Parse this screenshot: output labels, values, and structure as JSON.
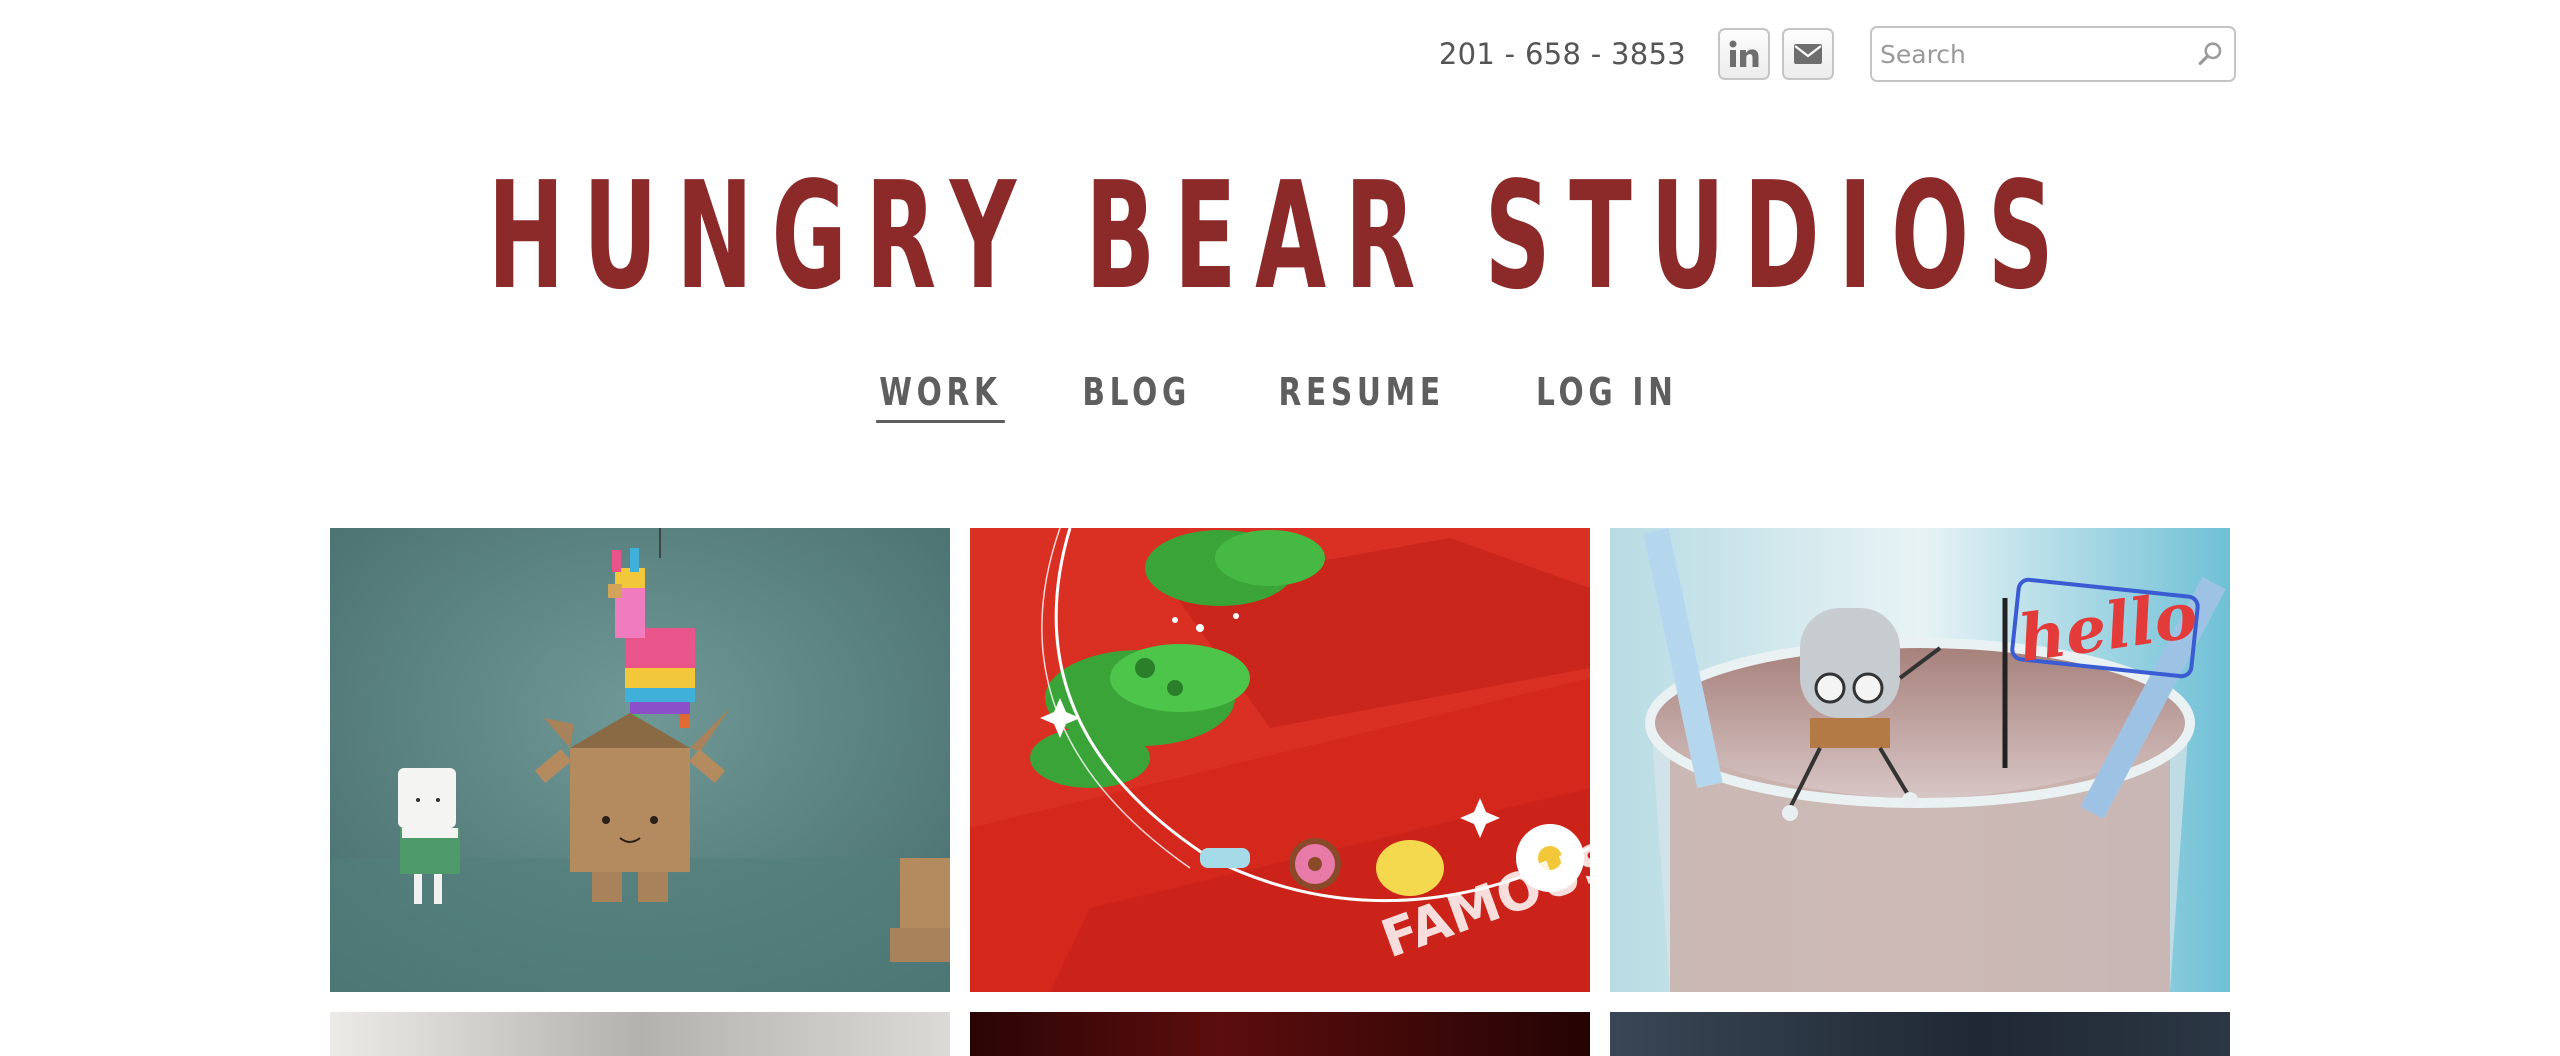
{
  "header": {
    "phone": "201 - 658 - 3853",
    "social": [
      {
        "name": "LinkedIn",
        "icon": "linkedin-icon",
        "glyph": "in"
      },
      {
        "name": "Email",
        "icon": "mail-icon"
      }
    ],
    "search": {
      "placeholder": "Search",
      "value": ""
    }
  },
  "site": {
    "title": "HUNGRY BEAR STUDIOS",
    "title_color": "#8c2a2a"
  },
  "nav": {
    "items": [
      {
        "label": "WORK",
        "active": true
      },
      {
        "label": "BLOG",
        "active": false
      },
      {
        "label": "RESUME",
        "active": false
      },
      {
        "label": "LOG IN",
        "active": false
      }
    ]
  },
  "gallery": {
    "tiles": [
      {
        "subject": "cardboard-box-pinata-scene",
        "background": "#5b8583"
      },
      {
        "subject": "green-crocs-red-steps-scene",
        "background": "#d4281d"
      },
      {
        "subject": "robot-on-milkshake-hello-sign-scene",
        "background": "#8fb9c4"
      },
      {
        "subject": "partial-tile-light-grey",
        "background": "#d9d6d1"
      },
      {
        "subject": "partial-tile-dark-red",
        "background": "#3a0a0a"
      },
      {
        "subject": "partial-tile-dark-blue",
        "background": "#2a3442"
      }
    ]
  }
}
